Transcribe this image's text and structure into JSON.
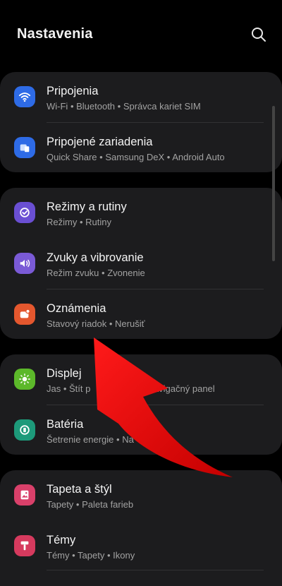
{
  "header": {
    "title": "Nastavenia"
  },
  "sections": [
    {
      "items": [
        {
          "title": "Pripojenia",
          "subtitle": [
            "Wi-Fi",
            "Bluetooth",
            "Správca kariet SIM"
          ],
          "icon": "wifi-icon",
          "color": "#2e6be6"
        },
        {
          "title": "Pripojené zariadenia",
          "subtitle": [
            "Quick Share",
            "Samsung DeX",
            "Android Auto"
          ],
          "icon": "devices-icon",
          "color": "#2e6be6"
        }
      ]
    },
    {
      "items": [
        {
          "title": "Režimy a rutiny",
          "subtitle": [
            "Režimy",
            "Rutiny"
          ],
          "icon": "modes-icon",
          "color": "#6a4fd3"
        },
        {
          "title": "Zvuky a vibrovanie",
          "subtitle": [
            "Režim zvuku",
            "Zvonenie"
          ],
          "icon": "sound-icon",
          "color": "#7a5ad6"
        },
        {
          "title": "Oznámenia",
          "subtitle": [
            "Stavový riadok",
            "Nerušiť"
          ],
          "icon": "notification-icon",
          "color": "#e4572e"
        }
      ]
    },
    {
      "items": [
        {
          "title": "Displej",
          "subtitle": [
            "Jas",
            "Štít p",
            "Navigačný panel"
          ],
          "icon": "brightness-icon",
          "color": "#5cb82a"
        },
        {
          "title": "Batéria",
          "subtitle": [
            "Šetrenie energie",
            "Na"
          ],
          "icon": "battery-icon",
          "color": "#1d9a7a"
        }
      ]
    },
    {
      "items": [
        {
          "title": "Tapeta a štýl",
          "subtitle": [
            "Tapety",
            "Paleta farieb"
          ],
          "icon": "wallpaper-icon",
          "color": "#d9406a"
        },
        {
          "title": "Témy",
          "subtitle": [
            "Témy",
            "Tapety",
            "Ikony"
          ],
          "icon": "themes-icon",
          "color": "#d63a5e"
        }
      ]
    }
  ],
  "colors": {
    "background": "#000000",
    "card": "#1c1c1e",
    "arrow": "#e00000"
  }
}
